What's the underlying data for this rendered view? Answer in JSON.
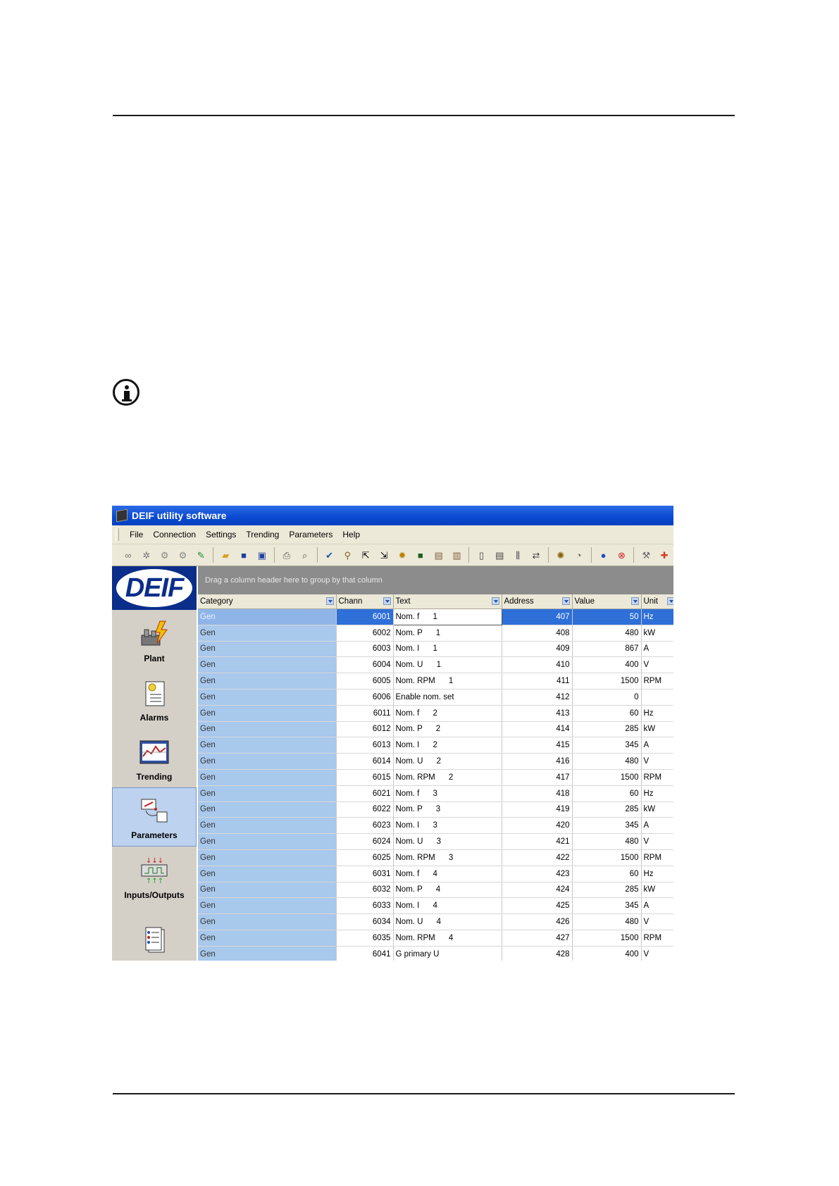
{
  "window": {
    "title": "DEIF utility software",
    "menu": [
      "File",
      "Connection",
      "Settings",
      "Trending",
      "Parameters",
      "Help"
    ]
  },
  "toolbar_icons": [
    "link-icon",
    "disconnect-icon",
    "read-icon",
    "write-icon",
    "wizard-icon",
    "open-icon",
    "save-icon",
    "save-all-icon",
    "print-icon",
    "preview-icon",
    "edit-icon",
    "search-icon",
    "upload-icon",
    "download-icon",
    "settings-icon",
    "stop-icon",
    "compare-icon",
    "merge-icon",
    "view1-icon",
    "view2-icon",
    "chart-icon",
    "swap-icon",
    "gear-icon",
    "timer-icon",
    "info-icon",
    "close-icon",
    "tools-icon",
    "pin-icon"
  ],
  "sidebar": {
    "logo": "DEIF",
    "items": [
      {
        "label": "Plant"
      },
      {
        "label": "Alarms"
      },
      {
        "label": "Trending"
      },
      {
        "label": "Parameters",
        "active": true
      },
      {
        "label": "Inputs/Outputs"
      },
      {
        "label": ""
      }
    ]
  },
  "grid": {
    "group_hint": "Drag a column header here to group by that column",
    "columns": [
      "Category",
      "Chann",
      "Text",
      "Address",
      "Value",
      "Unit"
    ],
    "rows": [
      [
        "Gen",
        "6001",
        "Nom. f      1",
        "407",
        "50",
        "Hz"
      ],
      [
        "Gen",
        "6002",
        "Nom. P      1",
        "408",
        "480",
        "kW"
      ],
      [
        "Gen",
        "6003",
        "Nom. I      1",
        "409",
        "867",
        "A"
      ],
      [
        "Gen",
        "6004",
        "Nom. U      1",
        "410",
        "400",
        "V"
      ],
      [
        "Gen",
        "6005",
        "Nom. RPM      1",
        "411",
        "1500",
        "RPM"
      ],
      [
        "Gen",
        "6006",
        "Enable nom. set",
        "412",
        "0",
        ""
      ],
      [
        "Gen",
        "6011",
        "Nom. f      2",
        "413",
        "60",
        "Hz"
      ],
      [
        "Gen",
        "6012",
        "Nom. P      2",
        "414",
        "285",
        "kW"
      ],
      [
        "Gen",
        "6013",
        "Nom. I      2",
        "415",
        "345",
        "A"
      ],
      [
        "Gen",
        "6014",
        "Nom. U      2",
        "416",
        "480",
        "V"
      ],
      [
        "Gen",
        "6015",
        "Nom. RPM      2",
        "417",
        "1500",
        "RPM"
      ],
      [
        "Gen",
        "6021",
        "Nom. f      3",
        "418",
        "60",
        "Hz"
      ],
      [
        "Gen",
        "6022",
        "Nom. P      3",
        "419",
        "285",
        "kW"
      ],
      [
        "Gen",
        "6023",
        "Nom. I      3",
        "420",
        "345",
        "A"
      ],
      [
        "Gen",
        "6024",
        "Nom. U      3",
        "421",
        "480",
        "V"
      ],
      [
        "Gen",
        "6025",
        "Nom. RPM      3",
        "422",
        "1500",
        "RPM"
      ],
      [
        "Gen",
        "6031",
        "Nom. f      4",
        "423",
        "60",
        "Hz"
      ],
      [
        "Gen",
        "6032",
        "Nom. P      4",
        "424",
        "285",
        "kW"
      ],
      [
        "Gen",
        "6033",
        "Nom. I      4",
        "425",
        "345",
        "A"
      ],
      [
        "Gen",
        "6034",
        "Nom. U      4",
        "426",
        "480",
        "V"
      ],
      [
        "Gen",
        "6035",
        "Nom. RPM      4",
        "427",
        "1500",
        "RPM"
      ],
      [
        "Gen",
        "6041",
        "G primary U",
        "428",
        "400",
        "V"
      ]
    ]
  }
}
